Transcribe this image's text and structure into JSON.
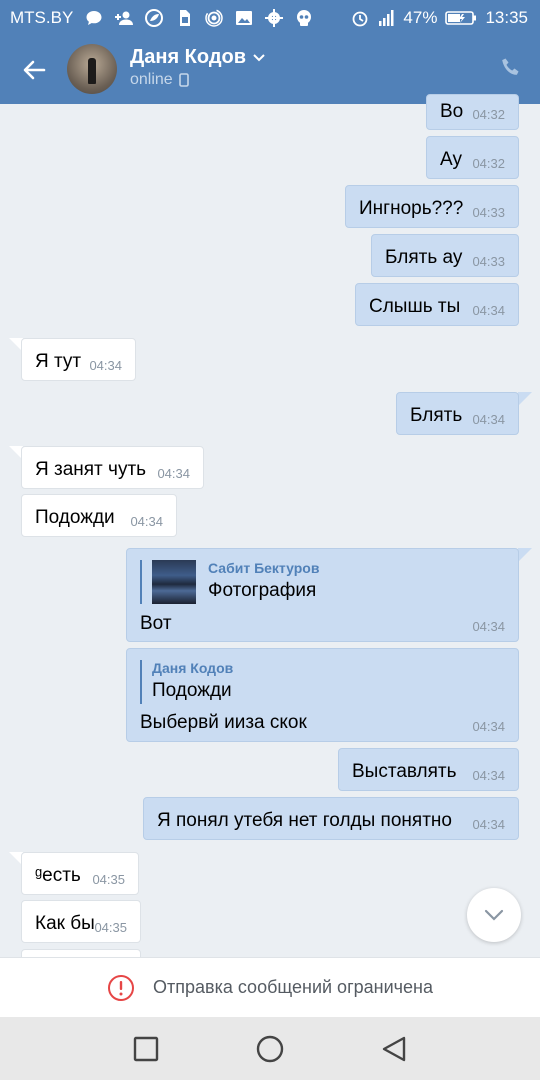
{
  "status_bar": {
    "carrier": "MTS.BY",
    "battery": "47%",
    "time": "13:35",
    "icons": [
      "chat-icon",
      "add-user-icon",
      "leaf-icon",
      "sim-icon",
      "hotspot-icon",
      "image-icon",
      "gear-icon",
      "skull-icon",
      "alarm-icon",
      "signal-icon",
      "battery-icon"
    ]
  },
  "header": {
    "contact_name": "Даня Кодов",
    "contact_status": "online",
    "colors": {
      "bar": "#5181b8"
    }
  },
  "messages": [
    {
      "text": "Во",
      "time": "04:32",
      "dir": "out"
    },
    {
      "text": "Ау",
      "time": "04:32",
      "dir": "out"
    },
    {
      "text": "Ингнорь???",
      "time": "04:33",
      "dir": "out"
    },
    {
      "text": "Блять ау",
      "time": "04:33",
      "dir": "out"
    },
    {
      "text": "Слышь ты",
      "time": "04:34",
      "dir": "out"
    },
    {
      "text": "Я тут",
      "time": "04:34",
      "dir": "in"
    },
    {
      "text": "Блять",
      "time": "04:34",
      "dir": "out"
    },
    {
      "text": "Я занят чуть",
      "time": "04:34",
      "dir": "in"
    },
    {
      "text": "Подожди",
      "time": "04:34",
      "dir": "in"
    },
    {
      "text": "Вот",
      "time": "04:34",
      "dir": "out",
      "forward": {
        "author": "Сабит Бектуров",
        "text": "Фотография"
      }
    },
    {
      "text": "Выбервй ииза скок",
      "time": "04:34",
      "dir": "out",
      "forward": {
        "author": "Даня Кодов",
        "text": "Подожди"
      }
    },
    {
      "text": "Выставлять",
      "time": "04:34",
      "dir": "out"
    },
    {
      "text": "Я понял утебя нет голды понятно",
      "time": "04:34",
      "dir": "out"
    },
    {
      "text": "ᵍесть",
      "time": "04:35",
      "dir": "in"
    },
    {
      "text": "Как бы",
      "time": "04:35",
      "dir": "in"
    }
  ],
  "restriction_notice": "Отправка сообщений ограничена",
  "nav": {
    "icons": [
      "recent-apps-icon",
      "home-icon",
      "back-icon"
    ]
  }
}
